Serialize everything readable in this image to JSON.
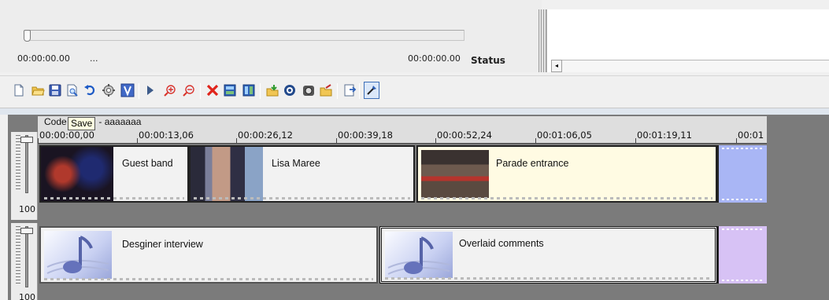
{
  "player": {
    "start_time": "00:00:00.00",
    "ellipsis": "...",
    "end_time": "00:00:00.00",
    "status_label": "Status",
    "scroll_left_glyph": "◂"
  },
  "toolbar": {
    "buttons": [
      "new-file-icon",
      "open-folder-icon",
      "save-icon",
      "print-preview-icon",
      "undo-icon",
      "settings-icon",
      "v-icon",
      "play-icon",
      "zoom-in-icon",
      "zoom-out-icon",
      "delete-icon",
      "clip-icon",
      "clip-split-icon",
      "import-icon",
      "record-icon",
      "camera-icon",
      "export-folder-icon",
      "properties-icon",
      "pointer-tool-icon"
    ]
  },
  "tooltip": {
    "text": "Save"
  },
  "timeline": {
    "code_label_prefix": "Code",
    "code_label_suffix": "- aaaaaaa",
    "ruler": [
      "00:00:00,00",
      "00:00:13,06",
      "00:00:26,12",
      "00:00:39,18",
      "00:00:52,24",
      "00:01:06,05",
      "00:01:19,11",
      "00:01"
    ],
    "tracks": [
      {
        "volume": "100",
        "clips": [
          "Guest band",
          "Lisa Maree",
          "Parade entrance"
        ]
      },
      {
        "volume": "100",
        "clips": [
          "Desginer interview",
          "Overlaid comments"
        ]
      }
    ]
  },
  "colors": {
    "video_end": "#a9b6f5",
    "audio_end": "#d7c2f5",
    "selected_clip": "#fffbe3",
    "timeline_bg": "#7b7b7b"
  }
}
